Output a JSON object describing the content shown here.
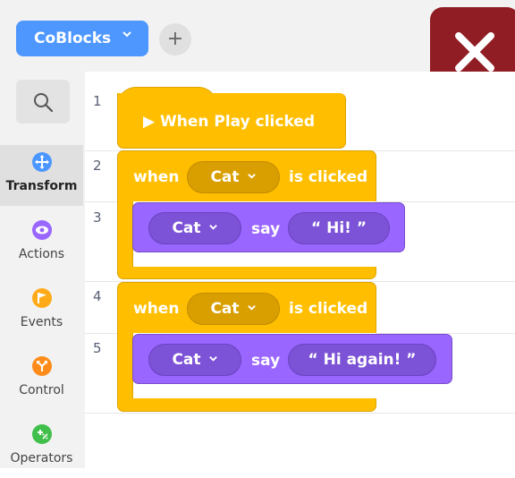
{
  "header": {
    "project_name": "CoBlocks",
    "project_menu_icon": "chevron-down-icon",
    "add_icon": "plus-icon",
    "close_icon": "close-icon"
  },
  "sidebar": {
    "search_icon": "search-icon",
    "categories": [
      {
        "label": "Transform",
        "color": "#4c97ff",
        "icon": "move-arrows-icon",
        "active": true
      },
      {
        "label": "Actions",
        "color": "#9966ff",
        "icon": "eye-icon",
        "active": false
      },
      {
        "label": "Events",
        "color": "#ffab19",
        "icon": "flag-icon",
        "active": false
      },
      {
        "label": "Control",
        "color": "#ff8c1a",
        "icon": "branch-arrows-icon",
        "active": false
      },
      {
        "label": "Operators",
        "color": "#40bf4a",
        "icon": "plus-minus-icon",
        "active": false
      }
    ]
  },
  "workspace": {
    "line_numbers": [
      "1",
      "2",
      "3",
      "4",
      "5"
    ],
    "hat_block": {
      "label": "▶ When Play clicked"
    },
    "event_blocks": [
      {
        "when_label": "when",
        "sprite": "Cat",
        "suffix": "is clicked",
        "say_block": {
          "sprite": "Cat",
          "say_label": "say",
          "message": "“ Hi! ”"
        }
      },
      {
        "when_label": "when",
        "sprite": "Cat",
        "suffix": "is clicked",
        "say_block": {
          "sprite": "Cat",
          "say_label": "say",
          "message": "“ Hi again! ”"
        }
      }
    ]
  },
  "colors": {
    "events_block": "#ffbf00",
    "looks_block": "#9966ff",
    "project_button": "#4d97ff",
    "close_button": "#901c24"
  }
}
